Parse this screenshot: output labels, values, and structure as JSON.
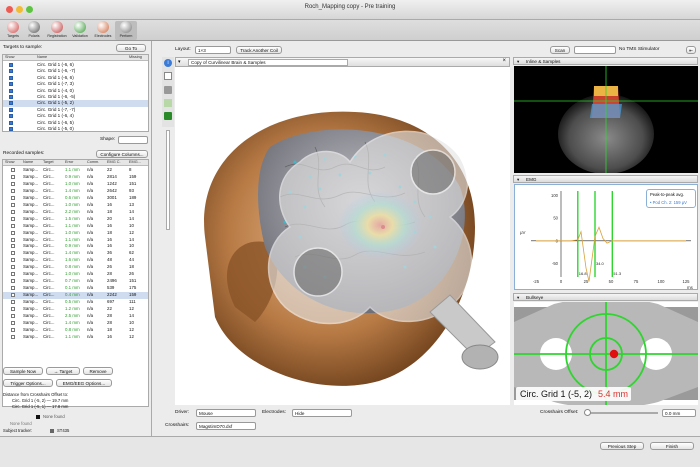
{
  "window": {
    "title": "Roch_Mapping copy - Pre training"
  },
  "toolbar": [
    {
      "label": "Targets",
      "color": "#d04a4a"
    },
    {
      "label": "Polaris",
      "color": "#555555"
    },
    {
      "label": "Registration",
      "color": "#c04040"
    },
    {
      "label": "Validation",
      "color": "#3a9a3a"
    },
    {
      "label": "Electrodes",
      "color": "#d06a40"
    },
    {
      "label": "Perform",
      "color": "#777777"
    }
  ],
  "targets": {
    "title": "Targets to sample:",
    "goto": "Go To",
    "col_show": "Show",
    "col_name": "Name",
    "col_missing": "Missing",
    "rows": [
      "Circ. Grid 1 (-6, 6)",
      "Circ. Grid 1 (-6, -7)",
      "Circ. Grid 1 (-6, 6)",
      "Circ. Grid 1 (-7, 3)",
      "Circ. Grid 1 (-4, 0)",
      "Circ. Grid 1 (-6, -5)",
      "Circ. Grid 1 (-5, 2)",
      "Circ. Grid 1 (-7, -7)",
      "Circ. Grid 1 (-6, 4)",
      "Circ. Grid 1 (-6, 5)",
      "Circ. Grid 1 (-5, 0)"
    ],
    "shape_label": "Shape:"
  },
  "samples": {
    "title": "Recorded samples:",
    "configure": "Configure Columns...",
    "cols": [
      "Show",
      "Name",
      "Target",
      "Error",
      "Comm.",
      "EMG C.",
      "EMG..."
    ],
    "rows": [
      [
        "Samp...",
        "Circ...",
        "1.1 mm",
        "n/a",
        "22",
        "8"
      ],
      [
        "Samp...",
        "Circ...",
        "0.9 mm",
        "n/a",
        "2814",
        "159"
      ],
      [
        "Samp...",
        "Circ...",
        "1.0 mm",
        "n/a",
        "1242",
        "151"
      ],
      [
        "Samp...",
        "Circ...",
        "1.4 mm",
        "n/a",
        "2642",
        "93"
      ],
      [
        "Samp...",
        "Circ...",
        "0.6 mm",
        "n/a",
        "3001",
        "189"
      ],
      [
        "Samp...",
        "Circ...",
        "1.0 mm",
        "n/a",
        "16",
        "13"
      ],
      [
        "Samp...",
        "Circ...",
        "2.2 mm",
        "n/a",
        "18",
        "14"
      ],
      [
        "Samp...",
        "Circ...",
        "1.5 mm",
        "n/a",
        "20",
        "14"
      ],
      [
        "Samp...",
        "Circ...",
        "1.1 mm",
        "n/a",
        "16",
        "10"
      ],
      [
        "Samp...",
        "Circ...",
        "1.0 mm",
        "n/a",
        "18",
        "12"
      ],
      [
        "Samp...",
        "Circ...",
        "1.1 mm",
        "n/a",
        "16",
        "14"
      ],
      [
        "Samp...",
        "Circ...",
        "0.9 mm",
        "n/a",
        "16",
        "10"
      ],
      [
        "Samp...",
        "Circ...",
        "1.4 mm",
        "n/a",
        "36",
        "62"
      ],
      [
        "Samp...",
        "Circ...",
        "1.6 mm",
        "n/a",
        "48",
        "44"
      ],
      [
        "Samp...",
        "Circ...",
        "0.8 mm",
        "n/a",
        "26",
        "18"
      ],
      [
        "Samp...",
        "Circ...",
        "1.0 mm",
        "n/a",
        "28",
        "26"
      ],
      [
        "Samp...",
        "Circ...",
        "0.7 mm",
        "n/a",
        "2496",
        "151"
      ],
      [
        "Samp...",
        "Circ...",
        "0.1 mm",
        "n/a",
        "539",
        "175"
      ],
      [
        "Samp...",
        "Circ...",
        "0.4 mm",
        "n/a",
        "2242",
        "159"
      ],
      [
        "Samp...",
        "Circ...",
        "0.5 mm",
        "n/a",
        "697",
        "111"
      ],
      [
        "Samp...",
        "Circ...",
        "1.2 mm",
        "n/a",
        "22",
        "12"
      ],
      [
        "Samp...",
        "Circ...",
        "2.5 mm",
        "n/a",
        "28",
        "14"
      ],
      [
        "Samp...",
        "Circ...",
        "1.4 mm",
        "n/a",
        "28",
        "10"
      ],
      [
        "Samp...",
        "Circ...",
        "0.8 mm",
        "n/a",
        "18",
        "12"
      ],
      [
        "Samp...",
        "Circ...",
        "1.1 mm",
        "n/a",
        "16",
        "12"
      ]
    ],
    "sample_now": "Sample Now",
    "target_btn": "→ Target",
    "remove": "Remove",
    "trigger": "Trigger Options...",
    "emg_options": "EMG/EEG Options...",
    "dist_title": "Distance from Crosshairs Offset to:",
    "dist1": "Circ. Grid 1 (-5, 2) — 19.7 mm",
    "dist2": "Circ. Grid 1 (-5, 1) — 17.8 mm",
    "none_found": "None found",
    "subject_tracker": "Subject tracker:",
    "st": "ST435"
  },
  "center": {
    "layout_label": "Layout:",
    "layout_value": "1×3",
    "track_btn": "Track Another Coil",
    "viewport_title": "Copy of Curvilinear Brain & Samples",
    "driver_label": "Driver:",
    "driver_value": "Mouse",
    "electrodes_label": "Electrodes:",
    "electrodes_value": "Hide",
    "crosshairs_label": "Crosshairs:",
    "crosshairs_value": "MagstimD70.dxf"
  },
  "right": {
    "scan": "Scan",
    "no_tms": "No TMS Stimulator",
    "inline_title": "Inline & Samples",
    "emg_title": "EMG",
    "bullseye_title": "Bullseye",
    "peak_title": "Peak-to-peak avg.",
    "peak_value": "• Pod Ch. 2: 159 μV",
    "target_name": "Circ. Grid 1 (-5, 2)",
    "target_dist": "5.4 mm",
    "offset_label": "Crosshairs Offset:",
    "offset_value": "0.0 mm",
    "y_unit": "μV",
    "x_unit": "ms",
    "marker1": "16.8",
    "marker2": "34.0",
    "marker3": "51.3"
  },
  "chart_data": {
    "type": "line",
    "title": "EMG",
    "xlabel": "ms",
    "ylabel": "μV",
    "x_ticks": [
      "-25",
      "0",
      "25",
      "50",
      "75",
      "100",
      "125"
    ],
    "y_ticks": [
      "100",
      "50",
      "0",
      "-50"
    ],
    "series": [
      {
        "name": "Pod Ch. 2",
        "x": [
          -25,
          0,
          10,
          16.8,
          20,
          25,
          28,
          31,
          34,
          38,
          42,
          46,
          51.3,
          60,
          75,
          100,
          125
        ],
        "y": [
          0,
          0,
          0,
          2,
          20,
          -60,
          -90,
          -40,
          10,
          30,
          5,
          -5,
          0,
          0,
          0,
          0,
          0
        ]
      }
    ],
    "markers": [
      16.8,
      34.0,
      51.3
    ],
    "xlim": [
      -30,
      130
    ],
    "ylim": [
      -80,
      110
    ]
  },
  "bottom": {
    "prev": "Previous Step",
    "finish": "Finish"
  }
}
